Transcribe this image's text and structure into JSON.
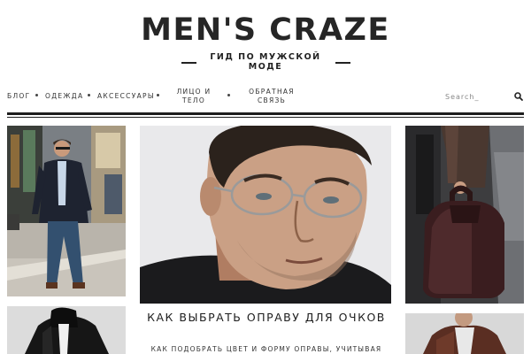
{
  "site": {
    "title": "MEN'S CRAZE",
    "tagline": "ГИД ПО МУЖСКОЙ МОДЕ"
  },
  "nav": {
    "items": [
      {
        "label": "БЛОГ"
      },
      {
        "label": "ОДЕЖДА"
      },
      {
        "label": "АКСЕССУАРЫ"
      },
      {
        "label": "ЛИЦО И ТЕЛО"
      },
      {
        "label": "ОБРАТНАЯ СВЯЗЬ"
      }
    ],
    "search_placeholder": "Search_",
    "search_icon": "search-icon"
  },
  "featured": {
    "title": "КАК ВЫБРАТЬ ОПРАВУ ДЛЯ ОЧКОВ",
    "excerpt": "КАК ПОДОБРАТЬ ЦВЕТ И ФОРМУ ОПРАВЫ, УЧИТЫВАЯ"
  },
  "colors": {
    "text": "#1b1b1b",
    "accent_rule": "#1e1e1e"
  }
}
